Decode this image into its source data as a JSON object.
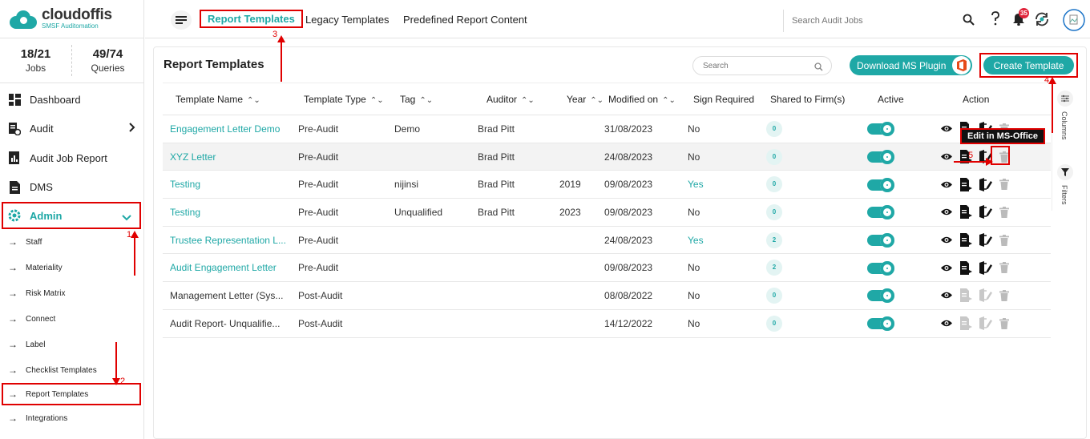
{
  "app": {
    "logo_name": "cloudoffis",
    "logo_sub": "SMSF Auditomation"
  },
  "stats": [
    {
      "value": "18/21",
      "label": "Jobs"
    },
    {
      "value": "49/74",
      "label": "Queries"
    }
  ],
  "nav": {
    "items": [
      {
        "label": "Dashboard",
        "icon": "dashboard-icon"
      },
      {
        "label": "Audit",
        "icon": "audit-icon"
      },
      {
        "label": "Audit Job Report",
        "icon": "report-icon"
      },
      {
        "label": "DMS",
        "icon": "document-icon"
      },
      {
        "label": "Admin",
        "icon": "gear-icon"
      }
    ],
    "sub_items": [
      "Staff",
      "Materiality",
      "Risk Matrix",
      "Connect",
      "Label",
      "Checklist Templates",
      "Report Templates",
      "Integrations"
    ]
  },
  "topbar": {
    "tabs": [
      "Report Templates",
      "Legacy Templates",
      "Predefined Report Content"
    ],
    "search_placeholder": "Search Audit Jobs",
    "notification_count": "35"
  },
  "main": {
    "title": "Report Templates",
    "search_placeholder": "Search",
    "plugin_button": "Download MS Plugin",
    "create_button": "Create Template",
    "columns": [
      "Template Name",
      "Template Type",
      "Tag",
      "Auditor",
      "Year",
      "Modified on",
      "Sign Required",
      "Shared to Firm(s)",
      "Active",
      "Action"
    ],
    "side_panel": {
      "columns_label": "Columns",
      "filters_label": "Filters"
    },
    "tooltip": "Edit in MS-Office",
    "rows": [
      {
        "name": "Engagement Letter Demo",
        "type": "Pre-Audit",
        "tag": "Demo",
        "auditor": "Brad Pitt",
        "year": "",
        "modified": "31/08/2023",
        "sign": "No",
        "shared": "0"
      },
      {
        "name": "XYZ Letter",
        "type": "Pre-Audit",
        "tag": "",
        "auditor": "Brad Pitt",
        "year": "",
        "modified": "24/08/2023",
        "sign": "No",
        "shared": "0"
      },
      {
        "name": "Testing",
        "type": "Pre-Audit",
        "tag": "nijinsi",
        "auditor": "Brad Pitt",
        "year": "2019",
        "modified": "09/08/2023",
        "sign": "Yes",
        "shared": "0"
      },
      {
        "name": "Testing",
        "type": "Pre-Audit",
        "tag": "Unqualified",
        "auditor": "Brad Pitt",
        "year": "2023",
        "modified": "09/08/2023",
        "sign": "No",
        "shared": "0"
      },
      {
        "name": "Trustee Representation L...",
        "type": "Pre-Audit",
        "tag": "",
        "auditor": "",
        "year": "",
        "modified": "24/08/2023",
        "sign": "Yes",
        "shared": "2"
      },
      {
        "name": "Audit Engagement Letter",
        "type": "Pre-Audit",
        "tag": "",
        "auditor": "",
        "year": "",
        "modified": "09/08/2023",
        "sign": "No",
        "shared": "2"
      },
      {
        "name": "Management Letter (Sys...",
        "type": "Post-Audit",
        "tag": "",
        "auditor": "",
        "year": "",
        "modified": "08/08/2022",
        "sign": "No",
        "shared": "0"
      },
      {
        "name": "Audit Report- Unqualifie...",
        "type": "Post-Audit",
        "tag": "",
        "auditor": "",
        "year": "",
        "modified": "14/12/2022",
        "sign": "No",
        "shared": "0"
      }
    ]
  },
  "annotations": [
    "1",
    "2",
    "3",
    "4",
    "5"
  ],
  "colors": {
    "accent": "#1fa8a6",
    "annotation": "#e00000"
  }
}
